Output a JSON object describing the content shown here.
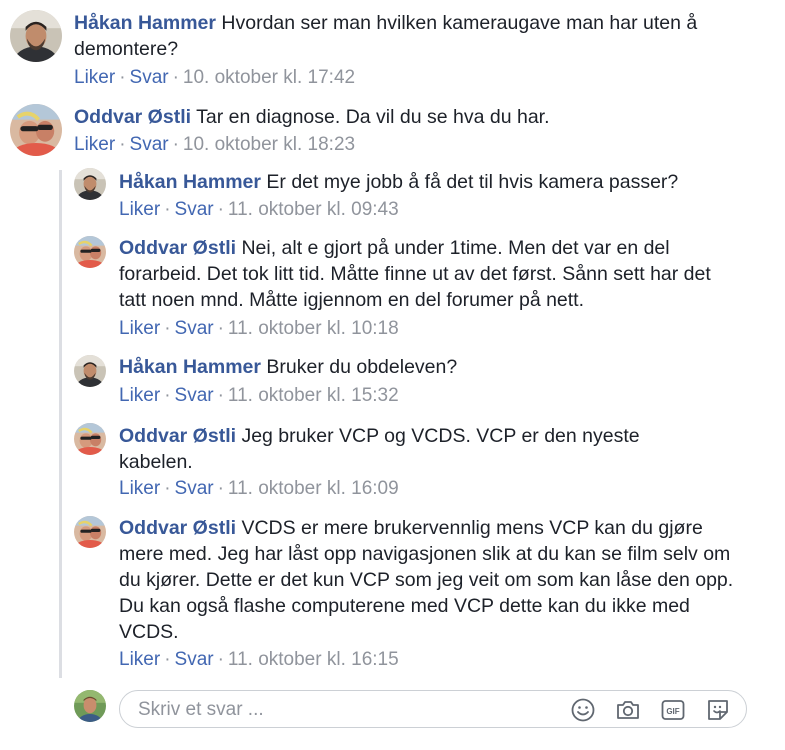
{
  "comments": [
    {
      "author": "Håkan Hammer",
      "text": "Hvordan ser man hvilken kameraugave man har uten å demontere?",
      "like": "Liker",
      "reply": "Svar",
      "time": "10. oktober kl. 17:42",
      "avatar": "hakan"
    },
    {
      "author": "Oddvar Østli",
      "text": "Tar en diagnose. Da vil du se hva du har.",
      "like": "Liker",
      "reply": "Svar",
      "time": "10. oktober kl. 18:23",
      "avatar": "oddvar"
    }
  ],
  "replies": [
    {
      "author": "Håkan Hammer",
      "text": "Er det mye jobb å få det til hvis kamera passer?",
      "like": "Liker",
      "reply": "Svar",
      "time": "11. oktober kl. 09:43",
      "avatar": "hakan"
    },
    {
      "author": "Oddvar Østli",
      "text": "Nei, alt e gjort på under 1time. Men det var en del forarbeid. Det tok litt tid. Måtte finne ut av det først. Sånn sett har det tatt noen mnd. Måtte igjennom en del forumer på nett.",
      "like": "Liker",
      "reply": "Svar",
      "time": "11. oktober kl. 10:18",
      "avatar": "oddvar"
    },
    {
      "author": "Håkan Hammer",
      "text": "Bruker du obdeleven?",
      "like": "Liker",
      "reply": "Svar",
      "time": "11. oktober kl. 15:32",
      "avatar": "hakan"
    },
    {
      "author": "Oddvar Østli",
      "text": "Jeg bruker VCP og VCDS. VCP er den nyeste kabelen.",
      "like": "Liker",
      "reply": "Svar",
      "time": "11. oktober kl. 16:09",
      "avatar": "oddvar"
    },
    {
      "author": "Oddvar Østli",
      "text": "VCDS er mere brukervennlig mens VCP kan du gjøre mere med. Jeg har låst opp navigasjonen slik at du kan se film selv om du kjører. Dette er det kun VCP som jeg veit om som kan låse den opp. Du kan også flashe computerene med VCP dette kan du ikke med VCDS.",
      "like": "Liker",
      "reply": "Svar",
      "time": "11. oktober kl. 16:15",
      "avatar": "oddvar"
    }
  ],
  "reply_box": {
    "placeholder": "Skriv et svar ...",
    "icons": [
      "emoji-icon",
      "camera-icon",
      "gif-icon",
      "sticker-icon"
    ]
  },
  "colors": {
    "author": "#385898",
    "link": "#4267b2",
    "meta": "#90949c"
  }
}
